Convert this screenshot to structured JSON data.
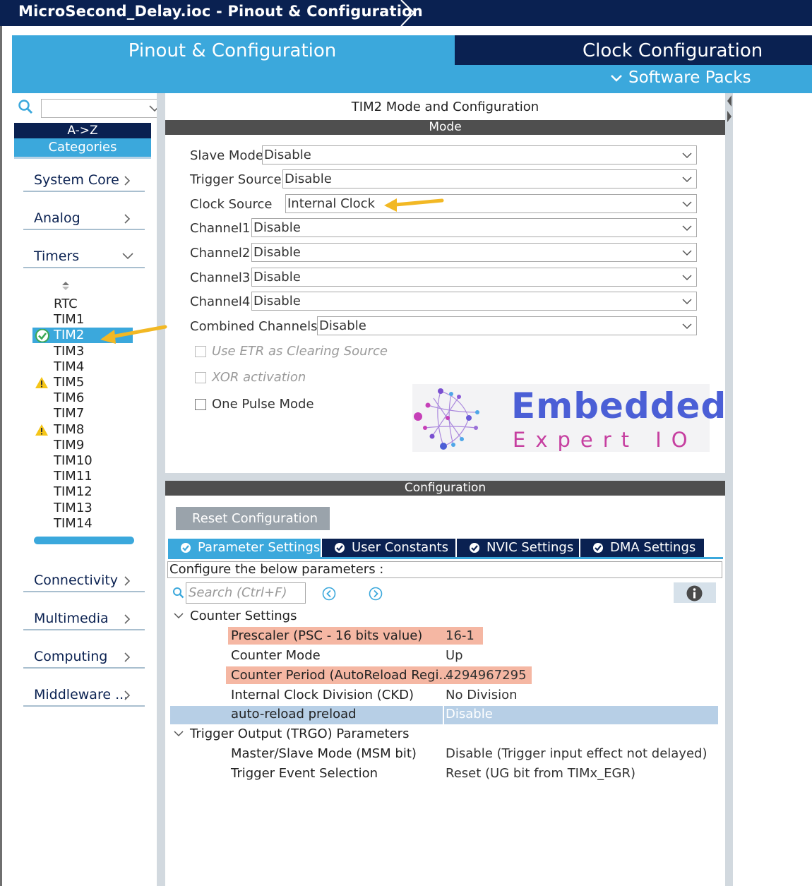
{
  "window": {
    "title": "MicroSecond_Delay.ioc - Pinout & Configuration"
  },
  "header": {
    "tab_pinout": "Pinout & Configuration",
    "tab_clock": "Clock Configuration",
    "software_packs": "Software Packs"
  },
  "sidebar": {
    "search_value": "",
    "sort_az": "A->Z",
    "categories_label": "Categories",
    "categories": [
      {
        "label": "System Core"
      },
      {
        "label": "Analog"
      },
      {
        "label": "Timers"
      },
      {
        "label": "Connectivity"
      },
      {
        "label": "Multimedia"
      },
      {
        "label": "Computing"
      },
      {
        "label": "Middleware ..."
      }
    ],
    "timers": [
      {
        "name": "RTC",
        "status": ""
      },
      {
        "name": "TIM1",
        "status": ""
      },
      {
        "name": "TIM2",
        "status": "ok"
      },
      {
        "name": "TIM3",
        "status": ""
      },
      {
        "name": "TIM4",
        "status": ""
      },
      {
        "name": "TIM5",
        "status": "warning"
      },
      {
        "name": "TIM6",
        "status": ""
      },
      {
        "name": "TIM7",
        "status": ""
      },
      {
        "name": "TIM8",
        "status": "warning"
      },
      {
        "name": "TIM9",
        "status": ""
      },
      {
        "name": "TIM10",
        "status": ""
      },
      {
        "name": "TIM11",
        "status": ""
      },
      {
        "name": "TIM12",
        "status": ""
      },
      {
        "name": "TIM13",
        "status": ""
      },
      {
        "name": "TIM14",
        "status": ""
      }
    ],
    "selected_timer": "TIM2"
  },
  "main": {
    "title": "TIM2 Mode and Configuration",
    "mode_header": "Mode",
    "mode_rows": [
      {
        "label": "Slave Mode",
        "value": "Disable"
      },
      {
        "label": "Trigger Source",
        "value": "Disable"
      },
      {
        "label": "Clock Source",
        "value": "Internal Clock"
      },
      {
        "label": "Channel1",
        "value": "Disable"
      },
      {
        "label": "Channel2",
        "value": "Disable"
      },
      {
        "label": "Channel3",
        "value": "Disable"
      },
      {
        "label": "Channel4",
        "value": "Disable"
      },
      {
        "label": "Combined Channels",
        "value": "Disable"
      }
    ],
    "checkboxes": [
      {
        "label": "Use ETR as Clearing Source",
        "enabled": false,
        "checked": false
      },
      {
        "label": "XOR activation",
        "enabled": false,
        "checked": false
      },
      {
        "label": "One Pulse Mode",
        "enabled": true,
        "checked": false
      }
    ],
    "logo": {
      "brand": "Embedded",
      "sub": "Expert IO"
    },
    "config_header": "Configuration",
    "reset_button": "Reset Configuration",
    "tabs": [
      {
        "label": "Parameter Settings",
        "active": true
      },
      {
        "label": "User Constants",
        "active": false
      },
      {
        "label": "NVIC Settings",
        "active": false
      },
      {
        "label": "DMA Settings",
        "active": false
      }
    ],
    "describe_text": "Configure the below parameters :",
    "search_placeholder": "Search (Ctrl+F)",
    "groups": [
      {
        "name": "Counter Settings",
        "params": [
          {
            "name": "Prescaler (PSC - 16 bits value)",
            "value": "16-1",
            "highlight": true
          },
          {
            "name": "Counter Mode",
            "value": "Up",
            "highlight": false
          },
          {
            "name": "Counter Period (AutoReload Regi...",
            "value": "4294967295",
            "highlight": true
          },
          {
            "name": "Internal Clock Division (CKD)",
            "value": "No Division",
            "highlight": false
          },
          {
            "name": "auto-reload preload",
            "value": "Disable",
            "selected": true
          }
        ]
      },
      {
        "name": "Trigger Output (TRGO) Parameters",
        "params": [
          {
            "name": "Master/Slave Mode (MSM bit)",
            "value": "Disable (Trigger input effect not delayed)"
          },
          {
            "name": "Trigger Event Selection",
            "value": "Reset (UG bit from TIMx_EGR)"
          }
        ]
      }
    ]
  },
  "colors": {
    "navy": "#0a2151",
    "accent_blue": "#3ba8dc",
    "highlight": "#f5b7a3",
    "selected_row": "#b7cfe6",
    "annotation_arrow": "#f2b824"
  },
  "icons": [
    "search-icon",
    "chevron-down-icon",
    "chevron-right-icon",
    "check-circle-icon",
    "warning-icon",
    "info-icon",
    "arrow-left-circle-icon",
    "arrow-right-circle-icon"
  ]
}
